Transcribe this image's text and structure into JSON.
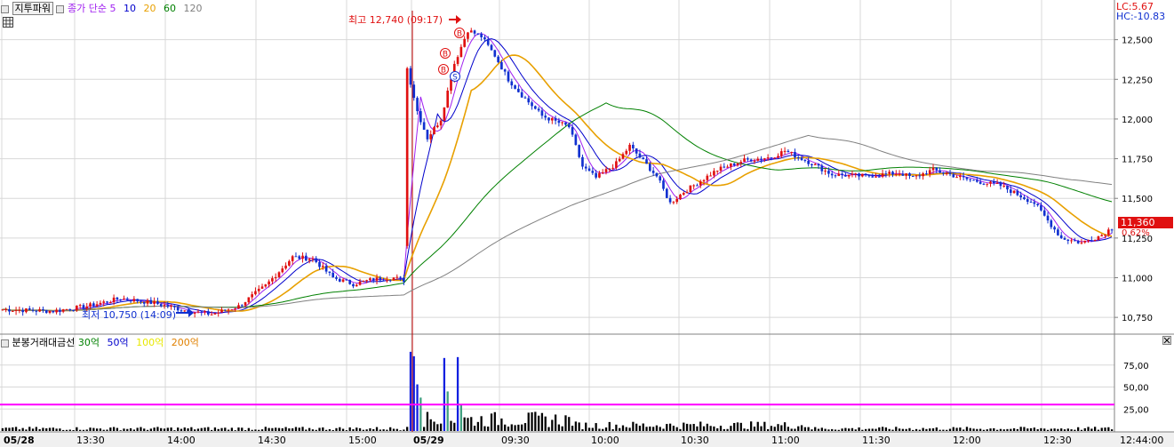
{
  "indicator_top": {
    "name": "지투파워",
    "ma_label": "종가 단순",
    "ma_periods": [
      {
        "label": "5",
        "color": "#a020f0"
      },
      {
        "label": "10",
        "color": "#0000cc"
      },
      {
        "label": "20",
        "color": "#e8a000"
      },
      {
        "label": "60",
        "color": "#008000"
      },
      {
        "label": "120",
        "color": "#808080"
      }
    ]
  },
  "indicator_bottom": {
    "name": "분봉거래대금선",
    "levels": [
      {
        "label": "30억",
        "color": "#008000"
      },
      {
        "label": "50억",
        "color": "#0000cc"
      },
      {
        "label": "100억",
        "color": "#e8e800"
      },
      {
        "label": "200억",
        "color": "#e08000"
      }
    ]
  },
  "info": {
    "lc": "LC:5.67",
    "hc": "HC:-10.83"
  },
  "annotations": {
    "high": "최고 12,740 (09:17)",
    "low": "최저 10,750 (14:09)",
    "signals": [
      "B",
      "B",
      "B",
      "S"
    ]
  },
  "current": {
    "price": "11,360",
    "change": "0.62%"
  },
  "x_axis_labels": [
    "05/28",
    "13:30",
    "14:00",
    "14:30",
    "15:00",
    "05/29",
    "09:30",
    "10:00",
    "10:30",
    "11:00",
    "11:30",
    "12:00",
    "12:30",
    "12:44:00"
  ],
  "price_axis_labels": [
    "12,500",
    "12,250",
    "12,000",
    "11,750",
    "11,500",
    "11,250",
    "11,000",
    "10,750"
  ],
  "volume_axis_labels": [
    "75,00",
    "50,00",
    "25,00"
  ],
  "colors": {
    "up": "#e01010",
    "down": "#1030d0",
    "grid": "#d8d8d8",
    "threshold": "#ff00ff",
    "separator": "#c00000"
  },
  "chart_data": {
    "type": "candlestick",
    "price_ylim": [
      10650,
      12750
    ],
    "volume_ylim": [
      0,
      100
    ],
    "volume_threshold": 30,
    "segments": [
      {
        "from": "05/28 13:10",
        "to": "05/28 15:20",
        "bars": 120,
        "anchors": [
          [
            0,
            10800
          ],
          [
            15,
            10790
          ],
          [
            25,
            10820
          ],
          [
            35,
            10870
          ],
          [
            45,
            10840
          ],
          [
            55,
            10790
          ],
          [
            62,
            10770
          ],
          [
            70,
            10820
          ],
          [
            78,
            10950
          ],
          [
            86,
            11130
          ],
          [
            92,
            11120
          ],
          [
            98,
            11000
          ],
          [
            104,
            10960
          ],
          [
            110,
            10990
          ],
          [
            116,
            11000
          ],
          [
            120,
            10980
          ]
        ]
      },
      {
        "from": "05/29 09:00",
        "to": "05/29 12:44",
        "bars": 210,
        "anchors": [
          [
            0,
            12320
          ],
          [
            3,
            12050
          ],
          [
            6,
            11880
          ],
          [
            10,
            12000
          ],
          [
            14,
            12350
          ],
          [
            18,
            12560
          ],
          [
            22,
            12520
          ],
          [
            26,
            12400
          ],
          [
            30,
            12250
          ],
          [
            34,
            12150
          ],
          [
            40,
            12020
          ],
          [
            48,
            11950
          ],
          [
            52,
            11700
          ],
          [
            56,
            11630
          ],
          [
            62,
            11720
          ],
          [
            66,
            11830
          ],
          [
            74,
            11640
          ],
          [
            78,
            11470
          ],
          [
            82,
            11540
          ],
          [
            92,
            11680
          ],
          [
            100,
            11740
          ],
          [
            108,
            11760
          ],
          [
            112,
            11800
          ],
          [
            120,
            11720
          ],
          [
            126,
            11650
          ],
          [
            136,
            11640
          ],
          [
            146,
            11660
          ],
          [
            150,
            11630
          ],
          [
            156,
            11680
          ],
          [
            166,
            11620
          ],
          [
            176,
            11580
          ],
          [
            186,
            11470
          ],
          [
            194,
            11250
          ],
          [
            200,
            11220
          ],
          [
            206,
            11270
          ],
          [
            212,
            11360
          ],
          [
            216,
            11420
          ],
          [
            222,
            11360
          ],
          [
            226,
            11320
          ]
        ]
      }
    ],
    "volume_spikes": [
      [
        121,
        90
      ],
      [
        122,
        85
      ],
      [
        123,
        53
      ],
      [
        124,
        38
      ],
      [
        131,
        83
      ],
      [
        132,
        45
      ],
      [
        135,
        84
      ],
      [
        136,
        30
      ]
    ],
    "series": [
      {
        "name": "5",
        "color": "#a020f0",
        "period": 5
      },
      {
        "name": "10",
        "color": "#0000cc",
        "period": 10
      },
      {
        "name": "20",
        "color": "#e8a000",
        "period": 20
      },
      {
        "name": "60",
        "color": "#008000",
        "period": 60
      },
      {
        "name": "120",
        "color": "#808080",
        "period": 120
      }
    ]
  }
}
